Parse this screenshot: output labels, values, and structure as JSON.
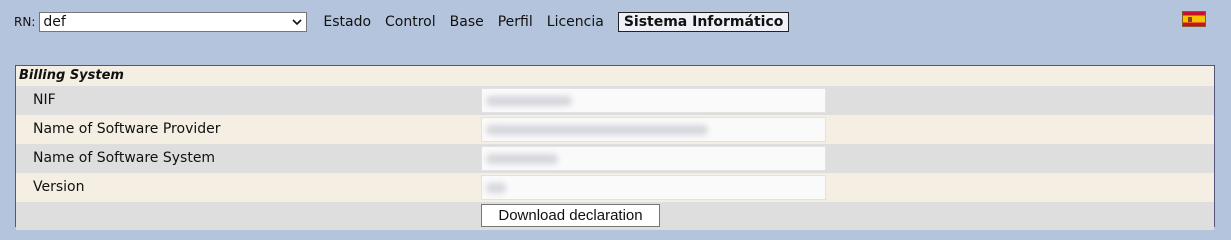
{
  "rn": {
    "label": "RN:",
    "selected": "def"
  },
  "nav": {
    "items": [
      "Estado",
      "Control",
      "Base",
      "Perfil",
      "Licencia"
    ],
    "active": "Sistema Informático"
  },
  "flag": {
    "icon": "spain-flag-icon",
    "colors": {
      "red": "#c8102e",
      "yellow": "#f6c200"
    }
  },
  "billing": {
    "title": "Billing System",
    "fields": [
      {
        "label": "NIF",
        "value": ""
      },
      {
        "label": "Name of Software Provider",
        "value": ""
      },
      {
        "label": "Name of Software System",
        "value": ""
      },
      {
        "label": "Version",
        "value": ""
      }
    ],
    "button": "Download declaration"
  },
  "colors": {
    "page_background": "#b4c4dc",
    "panel_beige": "#f5efe3",
    "row_grey": "#dedede",
    "panel_border": "#55557a"
  }
}
